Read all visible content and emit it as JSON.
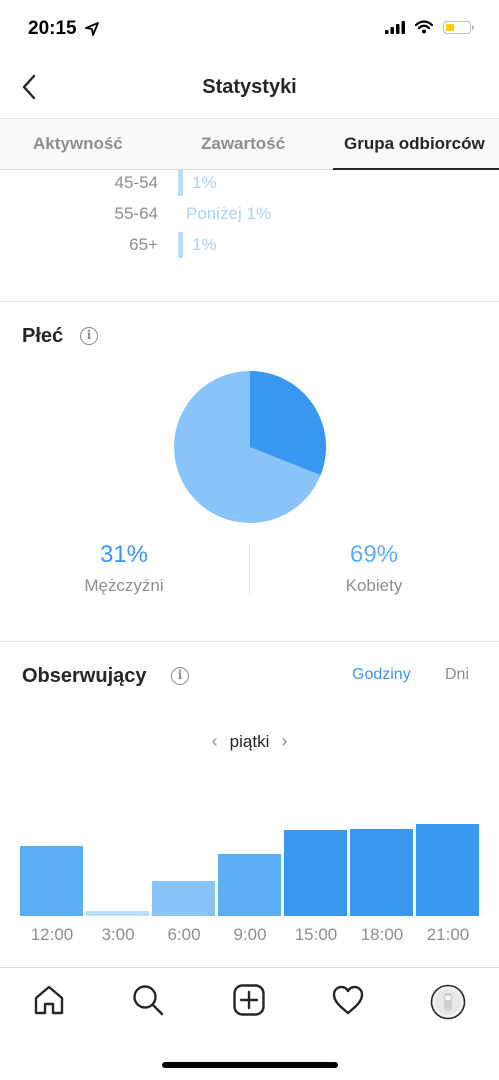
{
  "status_bar": {
    "time": "20:15",
    "battery_level": 0.35,
    "icons": [
      "location-arrow-icon",
      "cellular-signal-icon",
      "wifi-icon",
      "battery-icon"
    ]
  },
  "nav": {
    "title": "Statystyki",
    "back_icon": "chevron-left-icon"
  },
  "tabs": [
    {
      "label": "Aktywność",
      "active": false
    },
    {
      "label": "Zawartość",
      "active": false
    },
    {
      "label": "Grupa odbiorców",
      "active": true
    }
  ],
  "age_rows": [
    {
      "range": "45-54",
      "value": "1%",
      "has_bar": true
    },
    {
      "range": "55-64",
      "value": "Poniżej 1%",
      "has_bar": false
    },
    {
      "range": "65+",
      "value": "1%",
      "has_bar": true
    }
  ],
  "gender": {
    "title": "Płeć",
    "info_icon": "info-icon",
    "men": {
      "percent": "31%",
      "label": "Mężczyźni",
      "value": 31,
      "color": "#3897f0"
    },
    "women": {
      "percent": "69%",
      "label": "Kobiety",
      "value": 69,
      "color": "#88c4f9"
    }
  },
  "followers": {
    "title": "Obserwujący",
    "info_icon": "info-icon",
    "toggle": {
      "hours": "Godziny",
      "days": "Dni",
      "selected": "hours"
    },
    "day": "piątki",
    "prev_icon": "chevron-left-icon",
    "next_icon": "chevron-right-icon"
  },
  "chart_data": {
    "type": "bar",
    "categories": [
      "12:00",
      "3:00",
      "6:00",
      "9:00",
      "15:00",
      "18:00",
      "21:00"
    ],
    "values": [
      70,
      5,
      35,
      62,
      86,
      87,
      92
    ],
    "colors": [
      "#5aaef5",
      "#b8dcfb",
      "#88c4f9",
      "#5aaef5",
      "#3897f0",
      "#3897f0",
      "#3897f0"
    ],
    "ylim": [
      0,
      100
    ],
    "title": "",
    "xlabel": "",
    "ylabel": ""
  },
  "tab_bar": [
    "home-icon",
    "search-icon",
    "new-post-icon",
    "activity-heart-icon",
    "profile-avatar"
  ]
}
